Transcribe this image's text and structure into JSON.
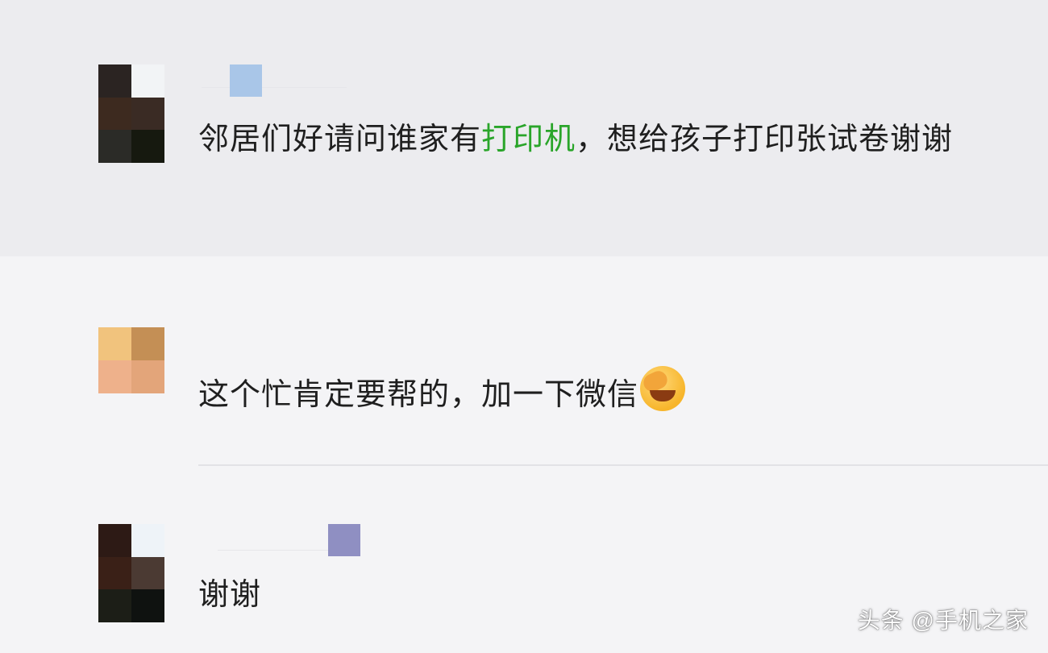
{
  "comments": [
    {
      "text_before": "邻居们好请问谁家有",
      "link_text": "打印机",
      "text_after": "，想给孩子打印张试卷谢谢",
      "avatar_colors": [
        "#2b2422",
        "#f2f4f6",
        "#3d2a1f",
        "#3a2b24",
        "#2b2b27",
        "#16190f"
      ],
      "badge_color": "#a9c6e8"
    },
    {
      "text": "这个忙肯定要帮的，加一下微信",
      "emoji": "face-palm-crying-emoji",
      "avatar_colors": [
        "#f1c37d",
        "#c48f55",
        "#eeb18b",
        "#e3a57a"
      ]
    },
    {
      "text": "谢谢",
      "avatar_colors": [
        "#2d1a15",
        "#eef3f8",
        "#3a2017",
        "#4b3a33",
        "#1c1e17",
        "#0f1210"
      ],
      "badge_color": "#8f8fc2"
    }
  ],
  "watermark": "头条 @手机之家",
  "link_color": "#2aa52a"
}
